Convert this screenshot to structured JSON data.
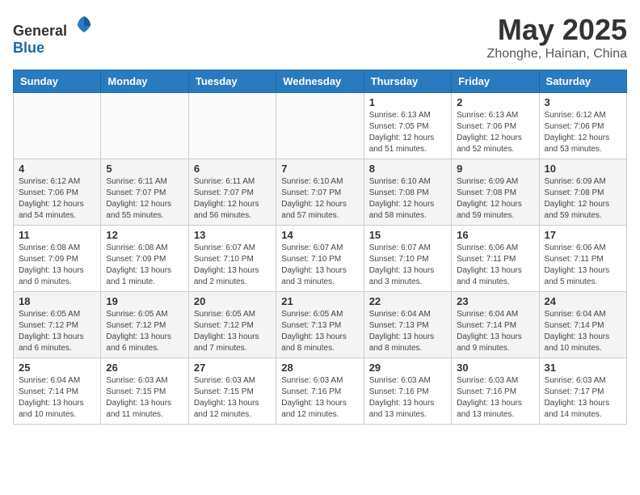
{
  "header": {
    "logo_general": "General",
    "logo_blue": "Blue",
    "month_year": "May 2025",
    "location": "Zhonghe, Hainan, China"
  },
  "days_of_week": [
    "Sunday",
    "Monday",
    "Tuesday",
    "Wednesday",
    "Thursday",
    "Friday",
    "Saturday"
  ],
  "weeks": [
    {
      "days": [
        {
          "number": "",
          "info": ""
        },
        {
          "number": "",
          "info": ""
        },
        {
          "number": "",
          "info": ""
        },
        {
          "number": "",
          "info": ""
        },
        {
          "number": "1",
          "info": "Sunrise: 6:13 AM\nSunset: 7:05 PM\nDaylight: 12 hours\nand 51 minutes."
        },
        {
          "number": "2",
          "info": "Sunrise: 6:13 AM\nSunset: 7:06 PM\nDaylight: 12 hours\nand 52 minutes."
        },
        {
          "number": "3",
          "info": "Sunrise: 6:12 AM\nSunset: 7:06 PM\nDaylight: 12 hours\nand 53 minutes."
        }
      ]
    },
    {
      "days": [
        {
          "number": "4",
          "info": "Sunrise: 6:12 AM\nSunset: 7:06 PM\nDaylight: 12 hours\nand 54 minutes."
        },
        {
          "number": "5",
          "info": "Sunrise: 6:11 AM\nSunset: 7:07 PM\nDaylight: 12 hours\nand 55 minutes."
        },
        {
          "number": "6",
          "info": "Sunrise: 6:11 AM\nSunset: 7:07 PM\nDaylight: 12 hours\nand 56 minutes."
        },
        {
          "number": "7",
          "info": "Sunrise: 6:10 AM\nSunset: 7:07 PM\nDaylight: 12 hours\nand 57 minutes."
        },
        {
          "number": "8",
          "info": "Sunrise: 6:10 AM\nSunset: 7:08 PM\nDaylight: 12 hours\nand 58 minutes."
        },
        {
          "number": "9",
          "info": "Sunrise: 6:09 AM\nSunset: 7:08 PM\nDaylight: 12 hours\nand 59 minutes."
        },
        {
          "number": "10",
          "info": "Sunrise: 6:09 AM\nSunset: 7:08 PM\nDaylight: 12 hours\nand 59 minutes."
        }
      ]
    },
    {
      "days": [
        {
          "number": "11",
          "info": "Sunrise: 6:08 AM\nSunset: 7:09 PM\nDaylight: 13 hours\nand 0 minutes."
        },
        {
          "number": "12",
          "info": "Sunrise: 6:08 AM\nSunset: 7:09 PM\nDaylight: 13 hours\nand 1 minute."
        },
        {
          "number": "13",
          "info": "Sunrise: 6:07 AM\nSunset: 7:10 PM\nDaylight: 13 hours\nand 2 minutes."
        },
        {
          "number": "14",
          "info": "Sunrise: 6:07 AM\nSunset: 7:10 PM\nDaylight: 13 hours\nand 3 minutes."
        },
        {
          "number": "15",
          "info": "Sunrise: 6:07 AM\nSunset: 7:10 PM\nDaylight: 13 hours\nand 3 minutes."
        },
        {
          "number": "16",
          "info": "Sunrise: 6:06 AM\nSunset: 7:11 PM\nDaylight: 13 hours\nand 4 minutes."
        },
        {
          "number": "17",
          "info": "Sunrise: 6:06 AM\nSunset: 7:11 PM\nDaylight: 13 hours\nand 5 minutes."
        }
      ]
    },
    {
      "days": [
        {
          "number": "18",
          "info": "Sunrise: 6:05 AM\nSunset: 7:12 PM\nDaylight: 13 hours\nand 6 minutes."
        },
        {
          "number": "19",
          "info": "Sunrise: 6:05 AM\nSunset: 7:12 PM\nDaylight: 13 hours\nand 6 minutes."
        },
        {
          "number": "20",
          "info": "Sunrise: 6:05 AM\nSunset: 7:12 PM\nDaylight: 13 hours\nand 7 minutes."
        },
        {
          "number": "21",
          "info": "Sunrise: 6:05 AM\nSunset: 7:13 PM\nDaylight: 13 hours\nand 8 minutes."
        },
        {
          "number": "22",
          "info": "Sunrise: 6:04 AM\nSunset: 7:13 PM\nDaylight: 13 hours\nand 8 minutes."
        },
        {
          "number": "23",
          "info": "Sunrise: 6:04 AM\nSunset: 7:14 PM\nDaylight: 13 hours\nand 9 minutes."
        },
        {
          "number": "24",
          "info": "Sunrise: 6:04 AM\nSunset: 7:14 PM\nDaylight: 13 hours\nand 10 minutes."
        }
      ]
    },
    {
      "days": [
        {
          "number": "25",
          "info": "Sunrise: 6:04 AM\nSunset: 7:14 PM\nDaylight: 13 hours\nand 10 minutes."
        },
        {
          "number": "26",
          "info": "Sunrise: 6:03 AM\nSunset: 7:15 PM\nDaylight: 13 hours\nand 11 minutes."
        },
        {
          "number": "27",
          "info": "Sunrise: 6:03 AM\nSunset: 7:15 PM\nDaylight: 13 hours\nand 12 minutes."
        },
        {
          "number": "28",
          "info": "Sunrise: 6:03 AM\nSunset: 7:16 PM\nDaylight: 13 hours\nand 12 minutes."
        },
        {
          "number": "29",
          "info": "Sunrise: 6:03 AM\nSunset: 7:16 PM\nDaylight: 13 hours\nand 13 minutes."
        },
        {
          "number": "30",
          "info": "Sunrise: 6:03 AM\nSunset: 7:16 PM\nDaylight: 13 hours\nand 13 minutes."
        },
        {
          "number": "31",
          "info": "Sunrise: 6:03 AM\nSunset: 7:17 PM\nDaylight: 13 hours\nand 14 minutes."
        }
      ]
    }
  ]
}
